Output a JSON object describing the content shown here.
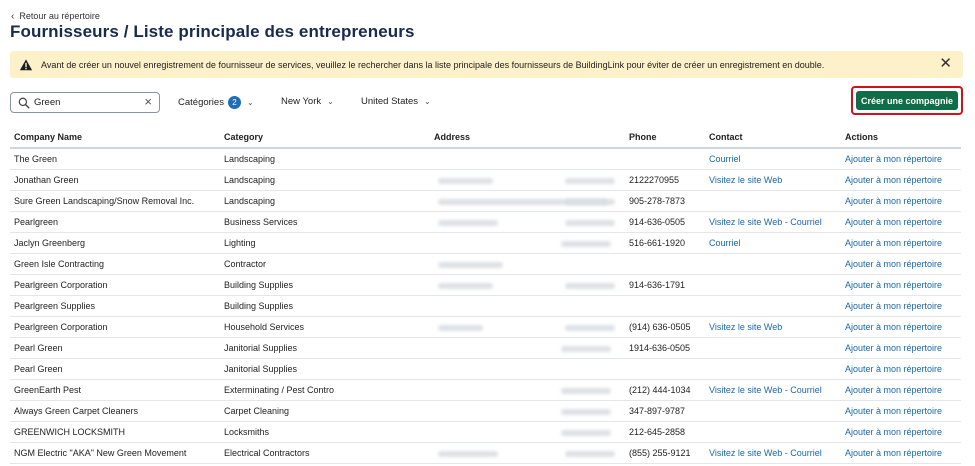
{
  "nav": {
    "back_label": "Retour au répertoire"
  },
  "page": {
    "title": "Fournisseurs / Liste principale des entrepreneurs"
  },
  "alert": {
    "message": "Avant de créer un nouvel enregistrement de fournisseur de services, veuillez le rechercher dans la liste principale des fournisseurs de BuildingLink pour éviter de créer un enregistrement en double.",
    "icon": "warning-icon",
    "color": "#fdf1c9"
  },
  "search": {
    "value": "Green",
    "placeholder": ""
  },
  "filters": {
    "categories_label": "Catégories",
    "categories_count": "2",
    "state_label": "New York",
    "country_label": "United States"
  },
  "actions": {
    "create_label": "Créer une compagnie",
    "create_color": "#0f6e47"
  },
  "table": {
    "headers": [
      "Company Name",
      "Category",
      "Address",
      "Phone",
      "Contact",
      "Actions"
    ],
    "rows": [
      {
        "name": "The Green",
        "category": "Landscaping",
        "phone": "",
        "contact": " Courriel",
        "action": "Ajouter à mon répertoire"
      },
      {
        "name": "Jonathan Green",
        "category": "Landscaping",
        "phone": "2122270955",
        "contact": "Visitez le site Web",
        "action": "Ajouter à mon répertoire"
      },
      {
        "name": "Sure Green Landscaping/Snow Removal Inc.",
        "category": "Landscaping",
        "phone": "905-278-7873",
        "contact": "",
        "action": "Ajouter à mon répertoire"
      },
      {
        "name": "Pearlgreen",
        "category": "Business Services",
        "phone": "914-636-0505",
        "contact": "Visitez le site Web - Courriel",
        "action": "Ajouter à mon répertoire"
      },
      {
        "name": "Jaclyn Greenberg",
        "category": "Lighting",
        "phone": "516-661-1920",
        "contact": " Courriel",
        "action": "Ajouter à mon répertoire"
      },
      {
        "name": "Green Isle Contracting",
        "category": "Contractor",
        "phone": "",
        "contact": "",
        "action": "Ajouter à mon répertoire"
      },
      {
        "name": "Pearlgreen Corporation",
        "category": "Building Supplies",
        "phone": "914-636-1791",
        "contact": "",
        "action": "Ajouter à mon répertoire"
      },
      {
        "name": "Pearlgreen Supplies",
        "category": "Building Supplies",
        "phone": "",
        "contact": "",
        "action": "Ajouter à mon répertoire"
      },
      {
        "name": "Pearlgreen Corporation",
        "category": "Household Services",
        "phone": "(914) 636-0505",
        "contact": "Visitez le site Web",
        "action": "Ajouter à mon répertoire"
      },
      {
        "name": "Pearl Green",
        "category": "Janitorial Supplies",
        "phone": "1914-636-0505",
        "contact": "",
        "action": "Ajouter à mon répertoire"
      },
      {
        "name": "Pearl Green",
        "category": "Janitorial Supplies",
        "phone": "",
        "contact": "",
        "action": "Ajouter à mon répertoire"
      },
      {
        "name": "GreenEarth Pest",
        "category": "Exterminating / Pest Contro",
        "phone": "(212) 444-1034",
        "contact": "Visitez le site Web - Courriel",
        "action": "Ajouter à mon répertoire"
      },
      {
        "name": "Always Green Carpet Cleaners",
        "category": "Carpet Cleaning",
        "phone": "347-897-9787",
        "contact": "",
        "action": "Ajouter à mon répertoire"
      },
      {
        "name": "GREENWICH LOCKSMITH",
        "category": "Locksmiths",
        "phone": "212-645-2858",
        "contact": "",
        "action": "Ajouter à mon répertoire"
      },
      {
        "name": "NGM Electric \"AKA\" New Green Movement",
        "category": "Electrical Contractors",
        "phone": "(855) 255-9121",
        "contact": "Visitez le site Web - Courriel",
        "action": "Ajouter à mon répertoire"
      }
    ]
  }
}
